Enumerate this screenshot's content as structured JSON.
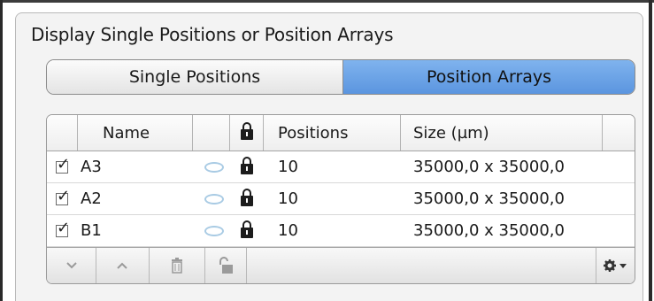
{
  "panel": {
    "title": "Display Single Positions or Position Arrays"
  },
  "segmented": {
    "single_label": "Single Positions",
    "arrays_label": "Position Arrays",
    "selected": "Position Arrays"
  },
  "table": {
    "headers": {
      "name": "Name",
      "positions": "Positions",
      "size": "Size (µm)"
    },
    "rows": [
      {
        "checked": true,
        "name": "A3",
        "positions": "10",
        "size": "35000,0 x 35000,0"
      },
      {
        "checked": true,
        "name": "A2",
        "positions": "10",
        "size": "35000,0 x 35000,0"
      },
      {
        "checked": true,
        "name": "B1",
        "positions": "10",
        "size": "35000,0 x 35000,0"
      }
    ]
  },
  "toolbar": {
    "buttons": [
      "chevron-down-icon",
      "chevron-up-icon",
      "trash-icon",
      "unlock-icon",
      "gear-dropdown-icon"
    ]
  },
  "icons": {
    "visibility": "ellipse-icon",
    "lock": "lock-icon"
  },
  "colors": {
    "accent": "#6aa3e8",
    "panel_bg": "#f3f3f3",
    "ellipse": "#a9cbe4"
  }
}
